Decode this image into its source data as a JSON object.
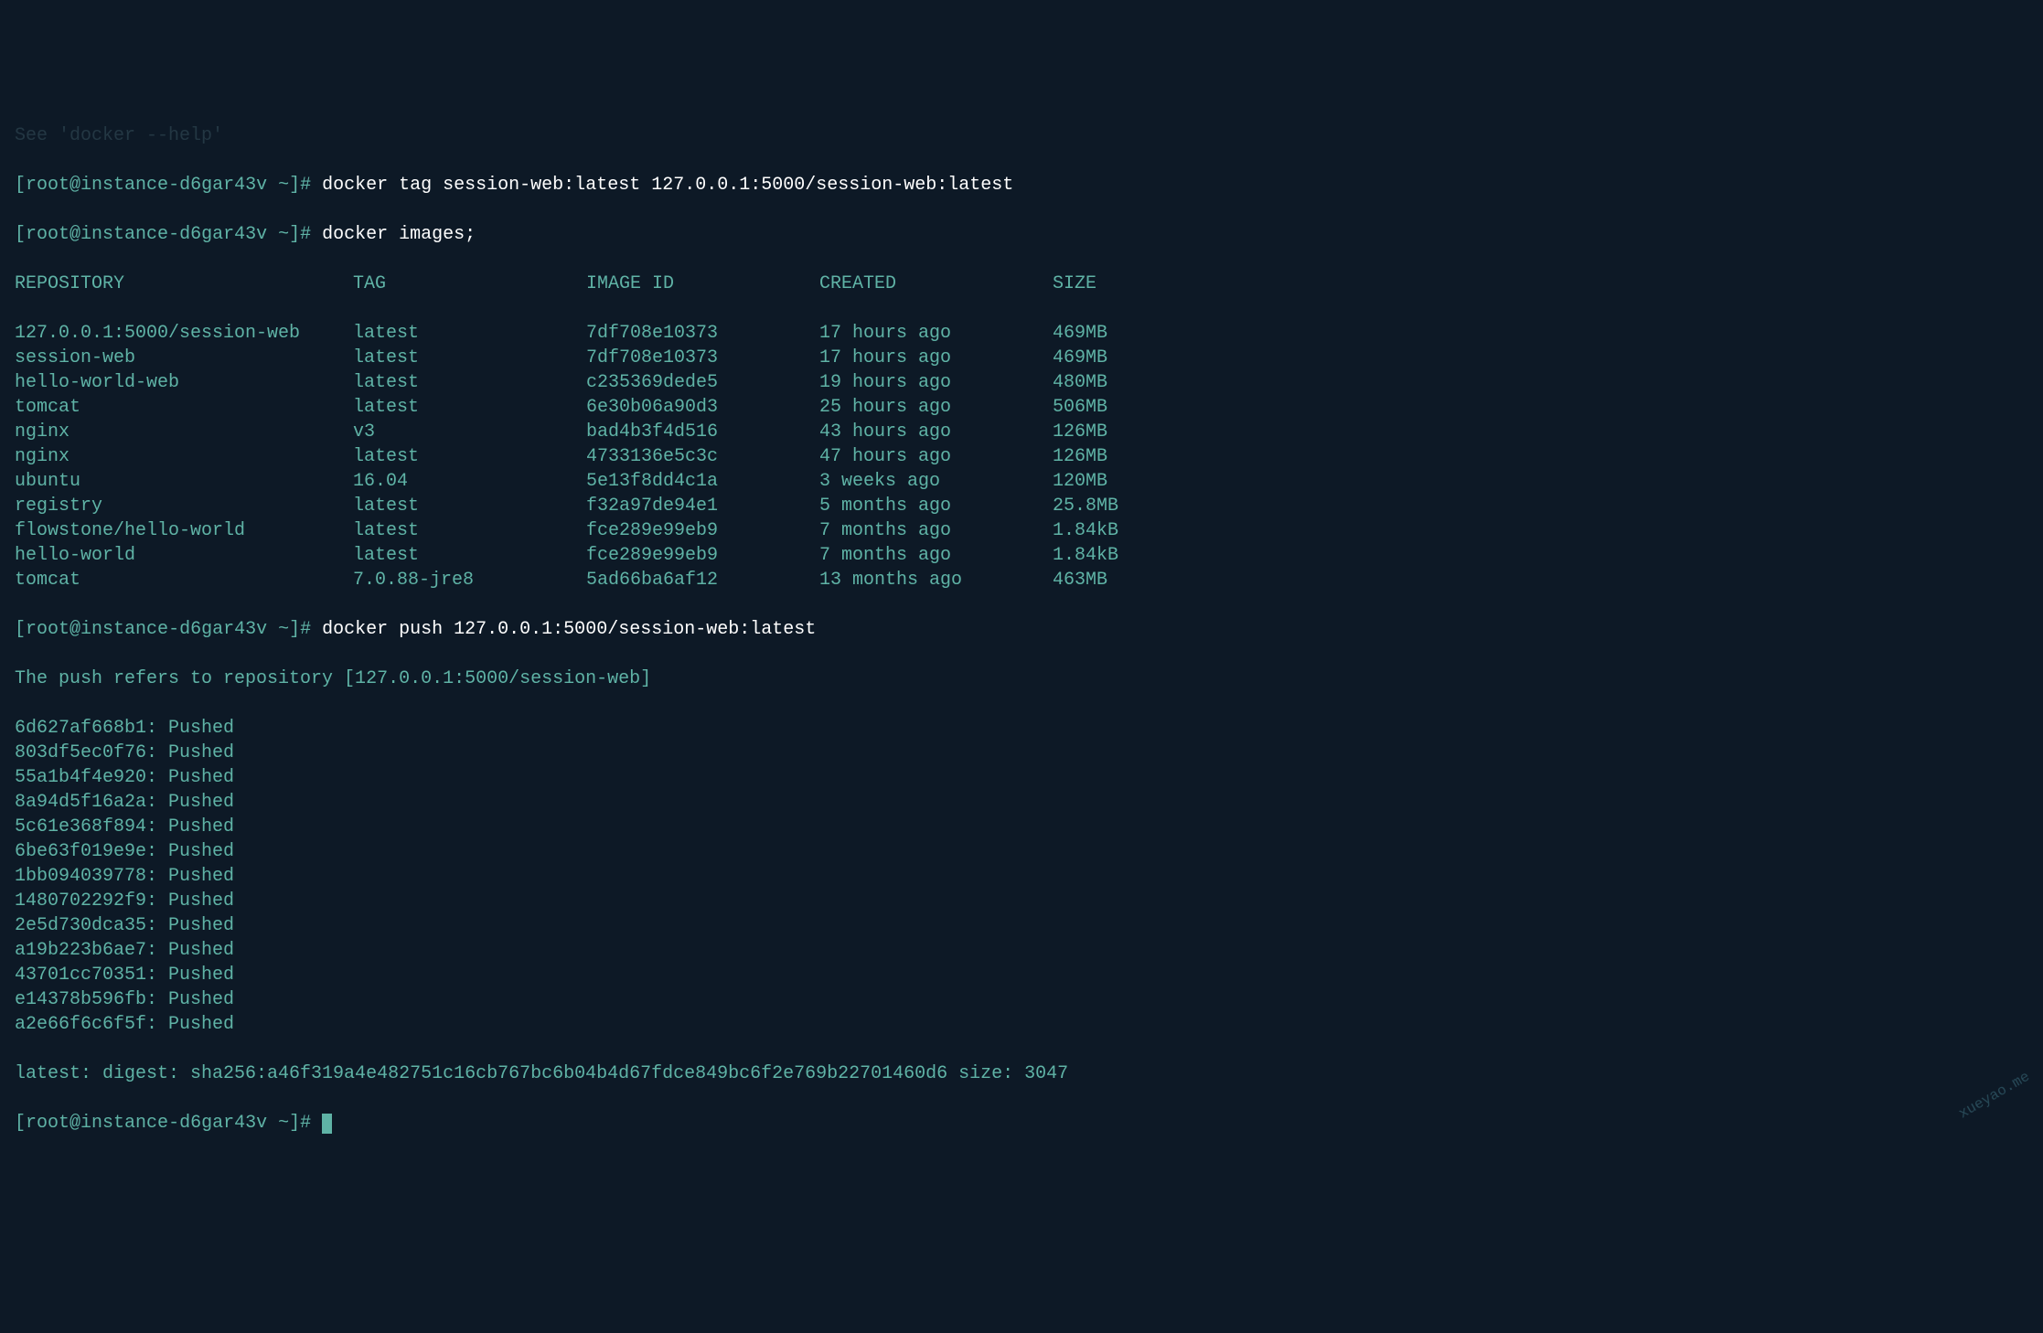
{
  "top_line": "See 'docker --help'",
  "prompt": {
    "user": "root",
    "host": "instance-d6gar43v",
    "path": "~",
    "open": "[",
    "at": "@",
    "close": "]# "
  },
  "commands": {
    "tag": "docker tag session-web:latest 127.0.0.1:5000/session-web:latest",
    "images": "docker images;",
    "push": "docker push 127.0.0.1:5000/session-web:latest"
  },
  "images_table": {
    "headers": {
      "repository": "REPOSITORY",
      "tag": "TAG",
      "image_id": "IMAGE ID",
      "created": "CREATED",
      "size": "SIZE"
    },
    "rows": [
      {
        "repository": "127.0.0.1:5000/session-web",
        "tag": "latest",
        "image_id": "7df708e10373",
        "created": "17 hours ago",
        "size": "469MB"
      },
      {
        "repository": "session-web",
        "tag": "latest",
        "image_id": "7df708e10373",
        "created": "17 hours ago",
        "size": "469MB"
      },
      {
        "repository": "hello-world-web",
        "tag": "latest",
        "image_id": "c235369dede5",
        "created": "19 hours ago",
        "size": "480MB"
      },
      {
        "repository": "tomcat",
        "tag": "latest",
        "image_id": "6e30b06a90d3",
        "created": "25 hours ago",
        "size": "506MB"
      },
      {
        "repository": "nginx",
        "tag": "v3",
        "image_id": "bad4b3f4d516",
        "created": "43 hours ago",
        "size": "126MB"
      },
      {
        "repository": "nginx",
        "tag": "latest",
        "image_id": "4733136e5c3c",
        "created": "47 hours ago",
        "size": "126MB"
      },
      {
        "repository": "ubuntu",
        "tag": "16.04",
        "image_id": "5e13f8dd4c1a",
        "created": "3 weeks ago",
        "size": "120MB"
      },
      {
        "repository": "registry",
        "tag": "latest",
        "image_id": "f32a97de94e1",
        "created": "5 months ago",
        "size": "25.8MB"
      },
      {
        "repository": "flowstone/hello-world",
        "tag": "latest",
        "image_id": "fce289e99eb9",
        "created": "7 months ago",
        "size": "1.84kB"
      },
      {
        "repository": "hello-world",
        "tag": "latest",
        "image_id": "fce289e99eb9",
        "created": "7 months ago",
        "size": "1.84kB"
      },
      {
        "repository": "tomcat",
        "tag": "7.0.88-jre8",
        "image_id": "5ad66ba6af12",
        "created": "13 months ago",
        "size": "463MB"
      }
    ]
  },
  "push_output": {
    "refers": "The push refers to repository [127.0.0.1:5000/session-web]",
    "layers": [
      {
        "hash": "6d627af668b1",
        "status": "Pushed"
      },
      {
        "hash": "803df5ec0f76",
        "status": "Pushed"
      },
      {
        "hash": "55a1b4f4e920",
        "status": "Pushed"
      },
      {
        "hash": "8a94d5f16a2a",
        "status": "Pushed"
      },
      {
        "hash": "5c61e368f894",
        "status": "Pushed"
      },
      {
        "hash": "6be63f019e9e",
        "status": "Pushed"
      },
      {
        "hash": "1bb094039778",
        "status": "Pushed"
      },
      {
        "hash": "1480702292f9",
        "status": "Pushed"
      },
      {
        "hash": "2e5d730dca35",
        "status": "Pushed"
      },
      {
        "hash": "a19b223b6ae7",
        "status": "Pushed"
      },
      {
        "hash": "43701cc70351",
        "status": "Pushed"
      },
      {
        "hash": "e14378b596fb",
        "status": "Pushed"
      },
      {
        "hash": "a2e66f6c6f5f",
        "status": "Pushed"
      }
    ],
    "digest": "latest: digest: sha256:a46f319a4e482751c16cb767bc6b04b4d67fdce849bc6f2e769b22701460d6 size: 3047"
  },
  "watermark": "xueyao.me"
}
